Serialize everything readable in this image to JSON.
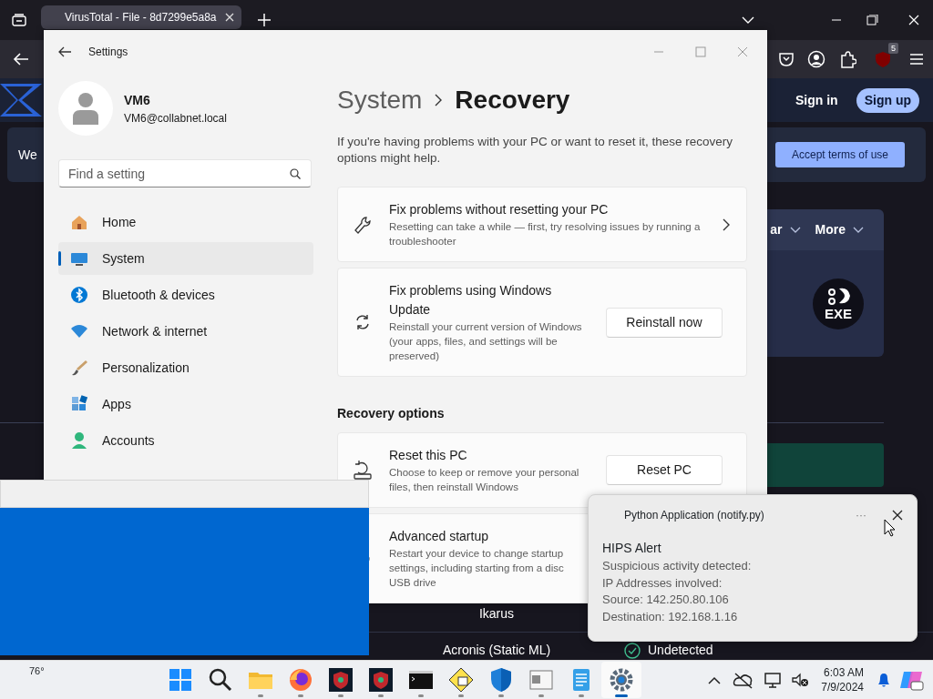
{
  "browser": {
    "tab_title": "VirusTotal - File - 8d7299e5a8a",
    "extension_badge": "5",
    "header_buttons": [
      {
        "kind": "text",
        "label": "Sign in"
      },
      {
        "kind": "pill",
        "label": "Sign up"
      }
    ],
    "banner_text": "We",
    "banner_button": "Accept terms of use",
    "menu_items": [
      "ar",
      "More"
    ],
    "file_type_badge": "EXE",
    "engines": [
      {
        "name": "Ikarus"
      },
      {
        "name": "Acronis (Static ML)",
        "result": "Undetected"
      }
    ]
  },
  "settings": {
    "title": "Settings",
    "user": {
      "name": "VM6",
      "email": "VM6@collabnet.local"
    },
    "search": {
      "placeholder": "Find a setting"
    },
    "nav": [
      {
        "label": "Home",
        "selected": false
      },
      {
        "label": "System",
        "selected": true
      },
      {
        "label": "Bluetooth & devices",
        "selected": false
      },
      {
        "label": "Network & internet",
        "selected": false
      },
      {
        "label": "Personalization",
        "selected": false
      },
      {
        "label": "Apps",
        "selected": false
      },
      {
        "label": "Accounts",
        "selected": false
      }
    ],
    "breadcrumb": [
      "System",
      "Recovery"
    ],
    "intro": "If you're having problems with your PC or want to reset it, these recovery options might help.",
    "cards": [
      {
        "kind": "link",
        "title": "Fix problems without resetting your PC",
        "description": "Resetting can take a while — first, try resolving issues by running a troubleshooter"
      },
      {
        "kind": "button",
        "title": "Fix problems using Windows Update",
        "description": "Reinstall your current version of Windows (your apps, files, and settings will be preserved)",
        "button": "Reinstall now"
      }
    ],
    "section_heading": "Recovery options",
    "options": [
      {
        "kind": "button",
        "title": "Reset this PC",
        "description": "Choose to keep or remove your personal files, then reinstall Windows",
        "button": "Reset PC"
      },
      {
        "kind": "plain",
        "title": "Advanced startup",
        "description": "Restart your device to change startup\nsettings, including starting from a disc\nUSB drive"
      }
    ]
  },
  "notification": {
    "app": "Python Application (notify.py)",
    "more": "···",
    "title": "HIPS Alert",
    "lines": [
      "Suspicious activity detected:",
      "IP Addresses involved:",
      "Source: 142.250.80.106",
      "Destination: 192.168.1.16"
    ]
  },
  "taskbar": {
    "weather": "76°",
    "apps": [
      {
        "running": false,
        "active": false
      },
      {
        "running": false,
        "active": false
      },
      {
        "running": true,
        "active": false
      },
      {
        "running": true,
        "active": false
      },
      {
        "running": true,
        "active": false
      },
      {
        "running": true,
        "active": false
      },
      {
        "running": true,
        "active": false
      },
      {
        "running": true,
        "active": false
      },
      {
        "running": true,
        "active": false
      },
      {
        "running": true,
        "active": false
      },
      {
        "running": true,
        "active": false
      },
      {
        "running": true,
        "active": true
      }
    ],
    "time": "6:03 AM",
    "date": "7/9/2024"
  }
}
